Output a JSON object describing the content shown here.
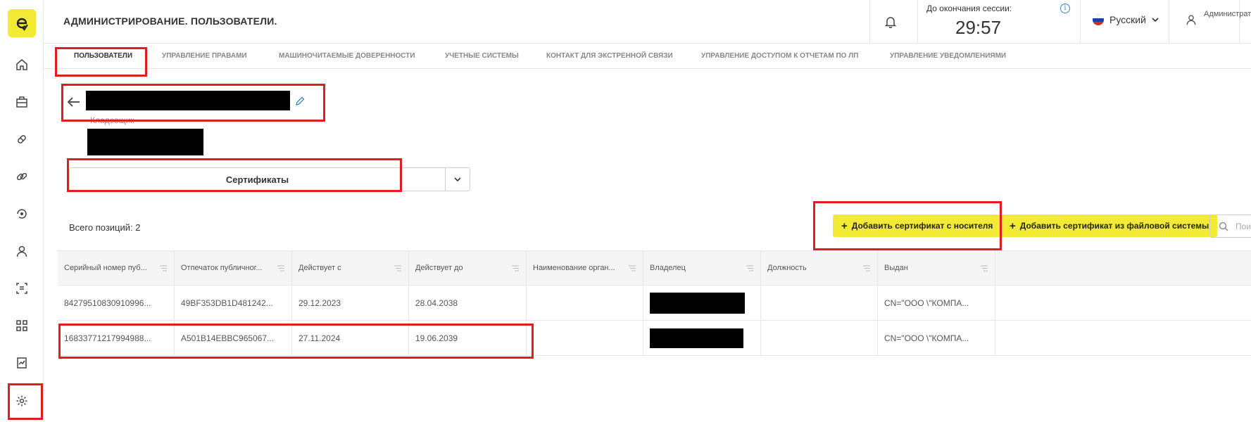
{
  "header": {
    "title": "АДМИНИСТРИРОВАНИЕ. ПОЛЬЗОВАТЕЛИ.",
    "session_label": "До окончания сессии:",
    "session_time": "29:57",
    "language": "Русский",
    "user": "Администратор"
  },
  "sidebar": {
    "items": [
      "home-icon",
      "briefcase-icon",
      "pill-icon",
      "link-icon",
      "refresh-eye-icon",
      "person-icon",
      "document-scan-icon",
      "qr-grid-icon",
      "chart-doc-icon",
      "gear-icon"
    ]
  },
  "tabs": [
    {
      "label": "ПОЛЬЗОВАТЕЛИ",
      "active": true
    },
    {
      "label": "УПРАВЛЕНИЕ ПРАВАМИ"
    },
    {
      "label": "МАШИНОЧИТАЕМЫЕ ДОВЕРЕННОСТИ"
    },
    {
      "label": "УЧЕТНЫЕ СИСТЕМЫ"
    },
    {
      "label": "КОНТАКТ ДЛЯ ЭКСТРЕННОЙ СВЯЗИ"
    },
    {
      "label": "УПРАВЛЕНИЕ ДОСТУПОМ К ОТЧЕТАМ ПО ЛП"
    },
    {
      "label": "УПРАВЛЕНИЕ УВЕДОМЛЕНИЯМИ"
    }
  ],
  "user_card": {
    "role": "Кладовщик"
  },
  "section": {
    "label": "Сертификаты"
  },
  "list": {
    "total": "Всего позиций: 2",
    "add_from_media": "Добавить сертификат с носителя",
    "add_from_file": "Добавить сертификат из файловой системы",
    "search_placeholder": "Пои"
  },
  "table": {
    "headers": [
      "Серийный номер пуб...",
      "Отпечаток публичног...",
      "Действует с",
      "Действует до",
      "Наименование орган...",
      "Владелец",
      "Должность",
      "Выдан"
    ],
    "rows": [
      [
        "84279510830910996...",
        "49BF353DB1D481242...",
        "29.12.2023",
        "28.04.2038",
        "",
        "",
        "",
        "CN=\"ООО \\\"КОМПА..."
      ],
      [
        "16833771217994988...",
        "A501B14EBBC965067...",
        "27.11.2024",
        "19.06.2039",
        "",
        "",
        "",
        "CN=\"ООО \\\"КОМПА..."
      ]
    ]
  },
  "colors": {
    "accent": "#f2ea35",
    "highlight": "#e01e1e"
  }
}
